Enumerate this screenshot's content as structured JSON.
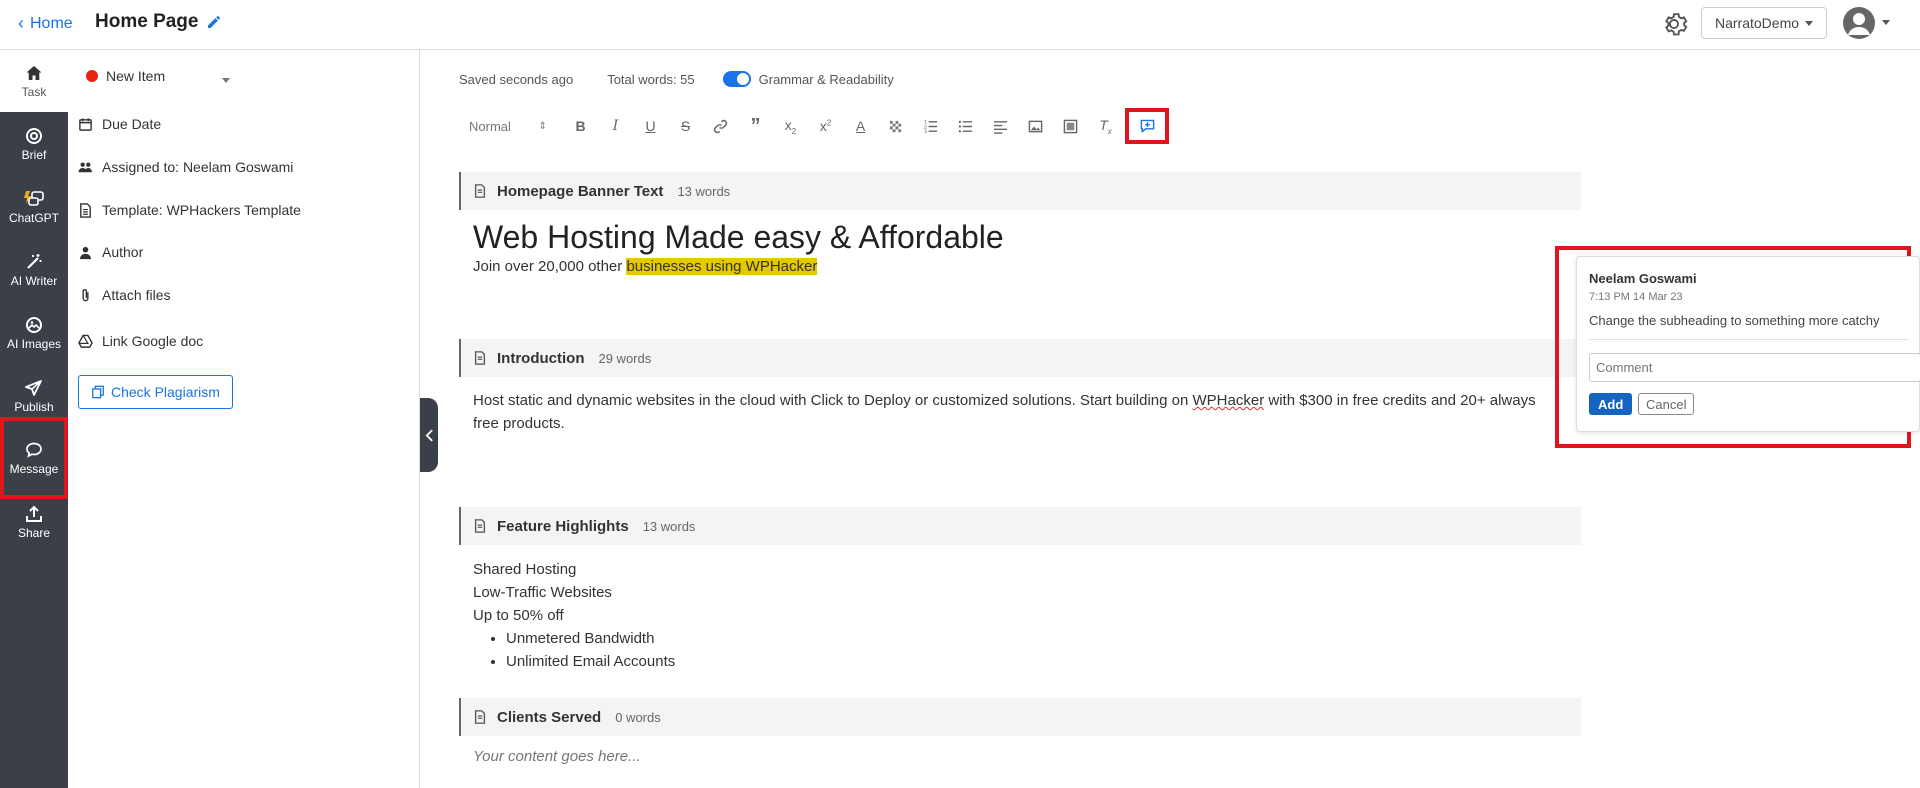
{
  "header": {
    "back_label": "Home",
    "title": "Home Page",
    "account_label": "NarratoDemo",
    "icons": [
      "chevron-left-icon",
      "pencil-icon",
      "gear-icon",
      "user-avatar-icon"
    ]
  },
  "rail": {
    "items": [
      {
        "label": "Task",
        "icon": "home-icon"
      },
      {
        "label": "Brief",
        "icon": "target-icon"
      },
      {
        "label": "ChatGPT",
        "icon": "chat-bubbles-icon"
      },
      {
        "label": "AI Writer",
        "icon": "magic-wand-icon"
      },
      {
        "label": "AI Images",
        "icon": "image-icon"
      },
      {
        "label": "Publish",
        "icon": "paper-plane-icon"
      },
      {
        "label": "Message",
        "icon": "message-icon"
      },
      {
        "label": "Share",
        "icon": "share-upload-icon"
      }
    ],
    "active": "Message"
  },
  "properties": {
    "status_label": "New Item",
    "status_color": "#e8230f",
    "due_date": "Due Date",
    "assigned": "Assigned to: Neelam Goswami",
    "template": "Template: WPHackers Template",
    "author": "Author",
    "attach": "Attach files",
    "google_doc": "Link Google doc",
    "plagiarism_button": "Check Plagiarism"
  },
  "editor": {
    "saved": "Saved seconds ago",
    "total_words": "Total words: 55",
    "grammar_toggle": "Grammar & Readability",
    "grammar_enabled": true,
    "format_select": "Normal",
    "toolbar_buttons": [
      "bold",
      "italic",
      "underline",
      "strikethrough",
      "link",
      "blockquote",
      "subscript",
      "superscript",
      "font-color",
      "background-color",
      "ordered-list",
      "bullet-list",
      "align",
      "image",
      "video",
      "clear-format",
      "add-comment"
    ],
    "sections": [
      {
        "title": "Homepage Banner Text",
        "count": "13 words",
        "heading": "Web Hosting Made easy & Affordable",
        "line_prefix": "Join over 20,000 other ",
        "line_highlight": "businesses using WPHacker"
      },
      {
        "title": "Introduction",
        "count": "29 words",
        "text_a": "Host static and dynamic websites in the cloud with Click to Deploy or customized solutions. Start building on ",
        "text_misspelled": "WPHacker",
        "text_b": " with $300 in free credits and 20+ always",
        "text_line2": "free products."
      },
      {
        "title": "Feature Highlights",
        "count": "13 words",
        "lines": [
          "Shared Hosting",
          "Low-Traffic Websites",
          "Up to 50% off"
        ],
        "bullets": [
          "Unmetered Bandwidth",
          "Unlimited Email Accounts"
        ]
      },
      {
        "title": "Clients Served",
        "count": "0 words",
        "placeholder": "Your content goes here..."
      }
    ]
  },
  "comment": {
    "author": "Neelam Goswami",
    "time": "7:13 PM 14 Mar 23",
    "text": "Change the subheading to something more catchy",
    "input_placeholder": "Comment",
    "add_label": "Add",
    "cancel_label": "Cancel"
  },
  "colors": {
    "accent": "#1a73e8",
    "rail_bg": "#3b3f47",
    "highlight": "#e4c800",
    "annotation_red": "#e0161f"
  }
}
